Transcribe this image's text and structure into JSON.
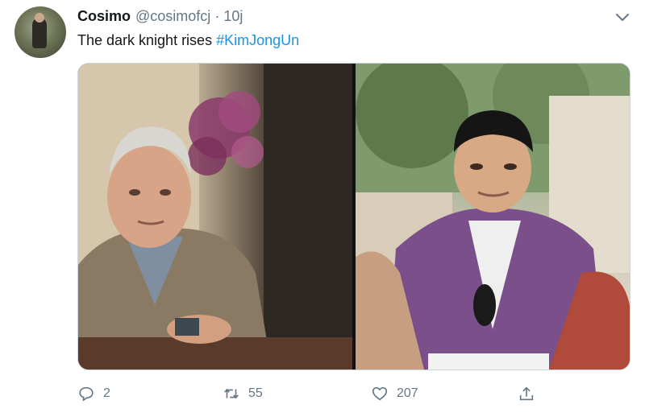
{
  "tweet": {
    "author_name": "Cosimo",
    "handle": "@cosimofcj",
    "separator": "·",
    "time": "10j",
    "text": "The dark knight rises ",
    "hashtag": "#KimJongUn",
    "reply_count": "2",
    "retweet_count": "55",
    "like_count": "207"
  },
  "media": {
    "left_image": "michael-caine-cafe-scene",
    "right_image": "kim-jong-un-cafe-scene"
  },
  "icons": {
    "more": "chevron-down-icon",
    "reply": "reply-icon",
    "retweet": "retweet-icon",
    "like": "heart-icon",
    "share": "share-icon"
  },
  "colors": {
    "text": "#14171a",
    "secondary": "#657786",
    "hashtag": "#1b95e0",
    "border": "#ccd6dd"
  }
}
